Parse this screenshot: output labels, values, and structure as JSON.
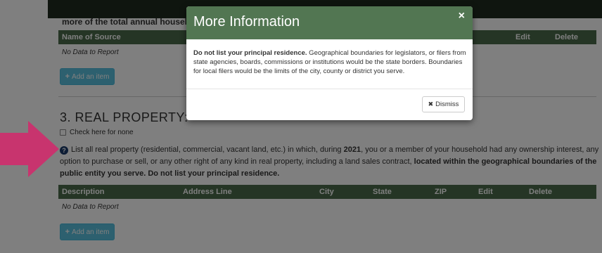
{
  "page": {
    "cut_heading": "more of the total annual household in",
    "table1": {
      "columns": [
        "Name of Source",
        "Edit",
        "Delete"
      ],
      "empty": "No Data to Report",
      "add_label": "Add an item"
    },
    "section3": {
      "title": "3. REAL PROPERTY:",
      "checkbox_label": "Check here for none",
      "help": {
        "part1": "List all real property (residential, commercial, vacant land, etc.) in which, during ",
        "year": "2021",
        "part2": ", you or a member of your household had any ownership interest, any option to purchase or sell, or any other right of any kind in real property, including a land sales contract, ",
        "bold": "located within the geographical boundaries of the public entity you serve. Do not list your principal residence."
      }
    },
    "table2": {
      "columns": [
        "Description",
        "Address Line",
        "City",
        "State",
        "ZIP",
        "Edit",
        "Delete"
      ],
      "empty": "No Data to Report",
      "add_label": "Add an item"
    }
  },
  "modal": {
    "title": "More Information",
    "close_glyph": "×",
    "body_bold": "Do not list your principal residence.",
    "body_rest": " Geographical boundaries for legislators, or filers from state agencies, boards, commissions or institutions would be the state borders. Boundaries for local filers would be the limits of the city, county or district you serve.",
    "dismiss_label": "Dismiss"
  },
  "colors": {
    "header_green": "#527652",
    "table_green": "#4a6b4a",
    "info_blue": "#5bc0de",
    "arrow_magenta": "#c8346e"
  }
}
